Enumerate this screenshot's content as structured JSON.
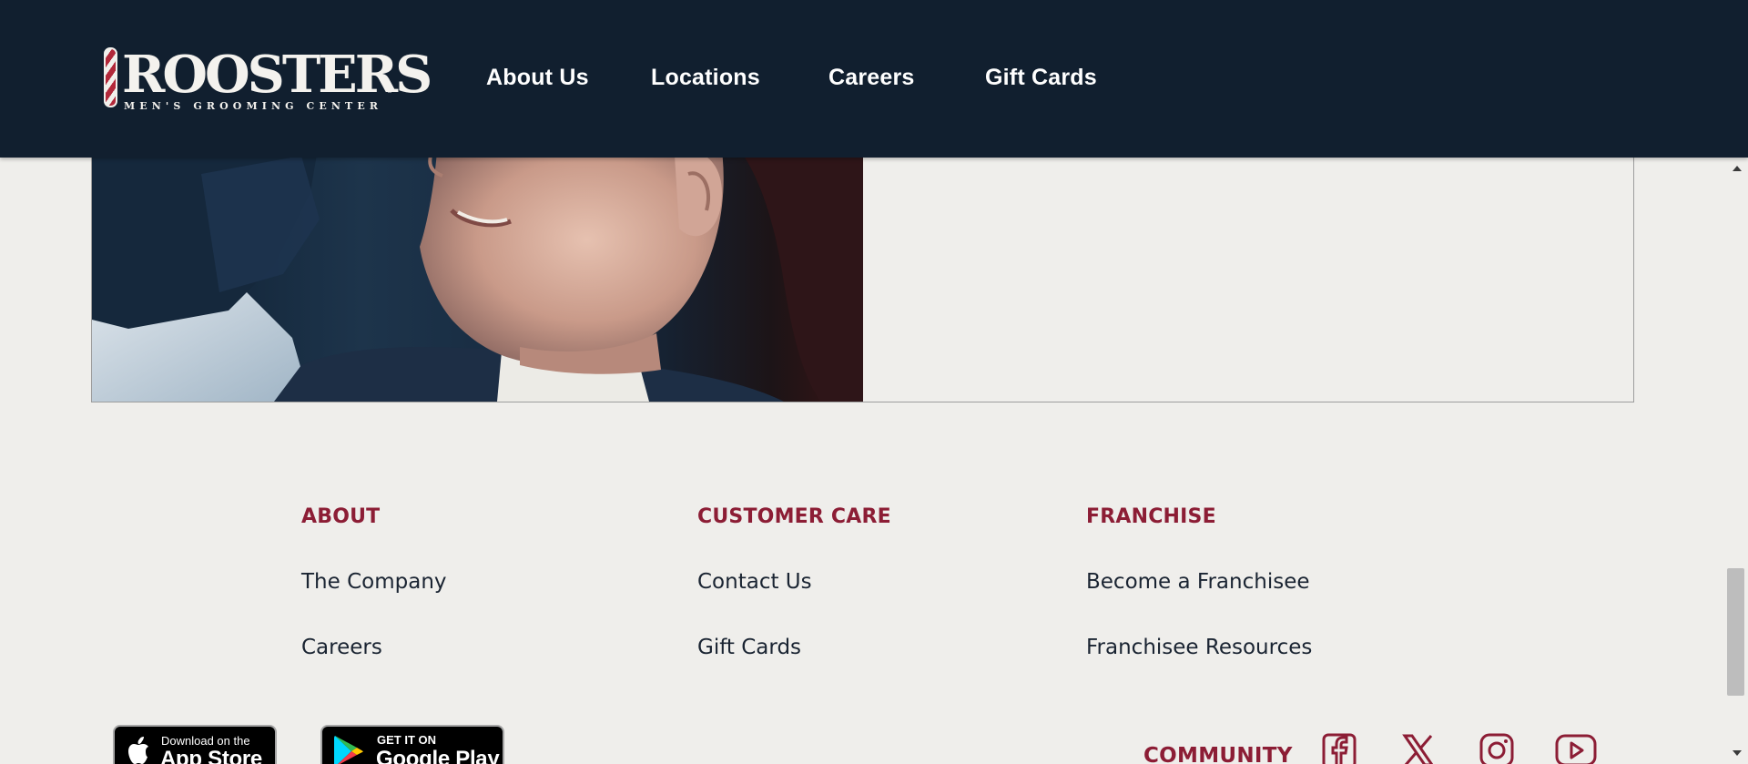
{
  "header": {
    "logo": {
      "wordmark": "ROOSTERS",
      "tagline": "MEN'S GROOMING CENTER",
      "reg_mark": "®"
    },
    "nav": [
      {
        "label": "About Us"
      },
      {
        "label": "Locations"
      },
      {
        "label": "Careers"
      },
      {
        "label": "Gift Cards"
      }
    ]
  },
  "footer": {
    "columns": [
      {
        "heading": "ABOUT",
        "links": [
          "The Company",
          "Careers"
        ]
      },
      {
        "heading": "CUSTOMER CARE",
        "links": [
          "Contact Us",
          "Gift Cards"
        ]
      },
      {
        "heading": "FRANCHISE",
        "links": [
          "Become a Franchisee",
          "Franchisee Resources"
        ]
      }
    ],
    "app_store": {
      "small": "Download on the",
      "big": "App Store"
    },
    "google_play": {
      "small": "GET IT ON",
      "big": "Google Play"
    },
    "community_label": "COMMUNITY",
    "social_icons": [
      "facebook-icon",
      "x-icon",
      "instagram-icon",
      "youtube-icon"
    ]
  },
  "colors": {
    "header_bg": "#111f2f",
    "page_bg": "#efeeeb",
    "accent": "#8c1d35",
    "link_text": "#1a2432"
  }
}
